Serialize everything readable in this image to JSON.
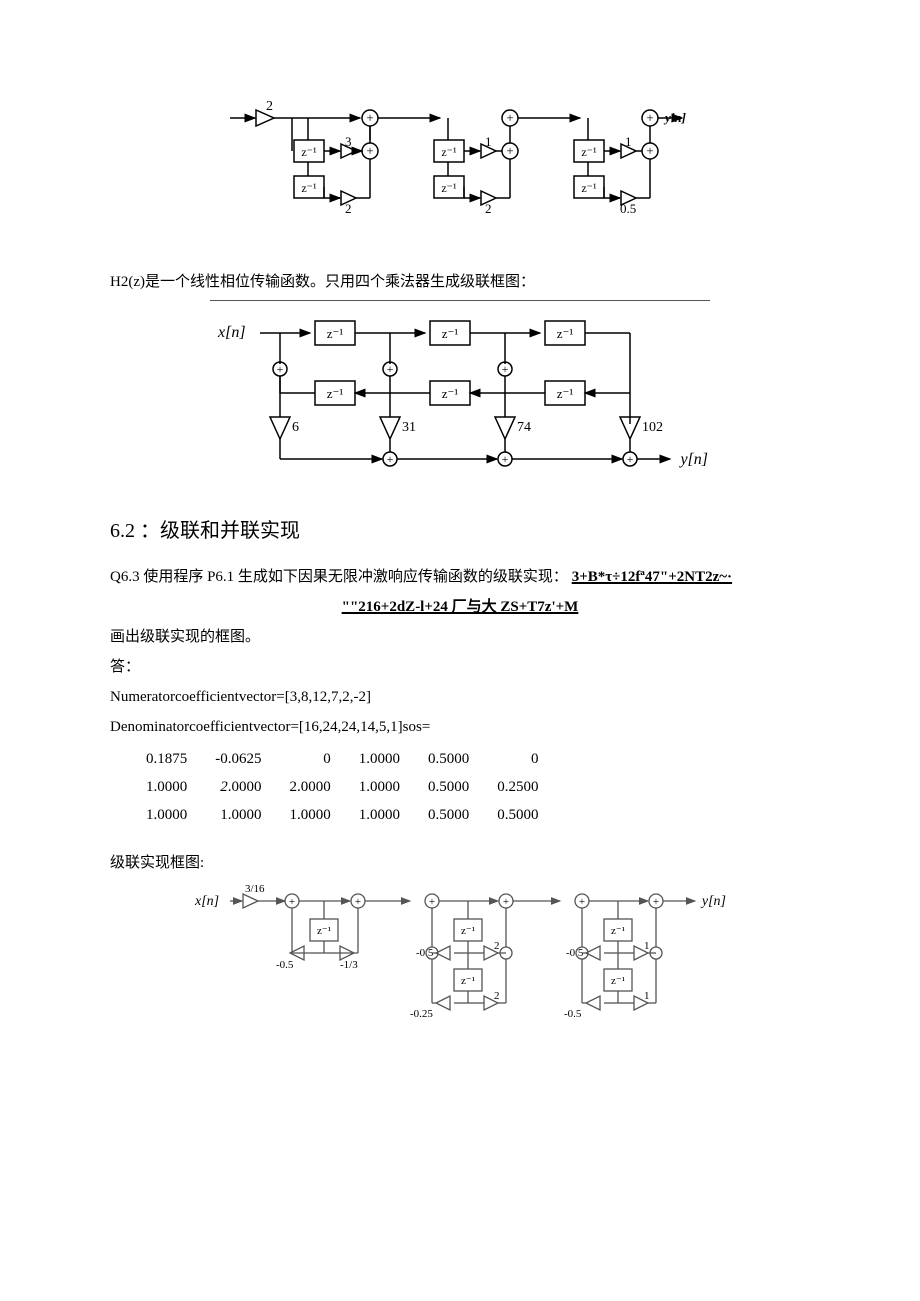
{
  "fig1": {
    "output": "yin]",
    "gains": {
      "in": "2",
      "a1": "3",
      "a2": "2",
      "b1": "1",
      "b2": "2",
      "c1": "1",
      "c2": "0.5"
    },
    "delay": "z⁻¹"
  },
  "line1": "H2(z)是一个线性相位传输函数。只用四个乘法器生成级联框图：",
  "fig2": {
    "in": "x[n]",
    "out": "y[n]",
    "delay": "z⁻¹",
    "gains": [
      "6",
      "31",
      "74",
      "102"
    ]
  },
  "sectTitle": "6.2 ：级联和并联实现",
  "q63_a": "Q6.3 使用程序 P6.1 生成如下因果无限冲激响应传输函数的级联实现：",
  "q63_b": "3+B*τ÷12fª47\"+2NT2z~·",
  "q63_c": "\"\"216+2dZ-l+24 厂与大 ZS+T7z'+M",
  "line2": "画出级联实现的框图。",
  "line3": "答：",
  "num_label": "Numeratorcoefficientvector=[3,8,12,7,2,-2]",
  "den_label": "Denominatorcoefficientvector=[16,24,24,14,5,1]sos=",
  "sos": {
    "r1": [
      "0.1875",
      "-0.0625",
      "0",
      "1.0000",
      "0.5000",
      "0"
    ],
    "r2": [
      "1.0000",
      "2.0000",
      "2.0000",
      "1.0000",
      "0.5000",
      "0.2500"
    ],
    "r3": [
      "1.0000",
      "1.0000",
      "1.0000",
      "1.0000",
      "0.5000",
      "0.5000"
    ]
  },
  "line4": "级联实现框图:",
  "fig3": {
    "in": "x[n]",
    "out": "y[n]",
    "delay": "z⁻¹",
    "g_in": "3/16",
    "s1": {
      "a": "-0.5",
      "b": "-1/3"
    },
    "s2": {
      "a1": "-0.5",
      "b1": "2",
      "a2": "-0.25",
      "b2": "2"
    },
    "s3": {
      "a1": "-0.5",
      "b1": "1",
      "a2": "-0.5",
      "b2": "1"
    }
  }
}
